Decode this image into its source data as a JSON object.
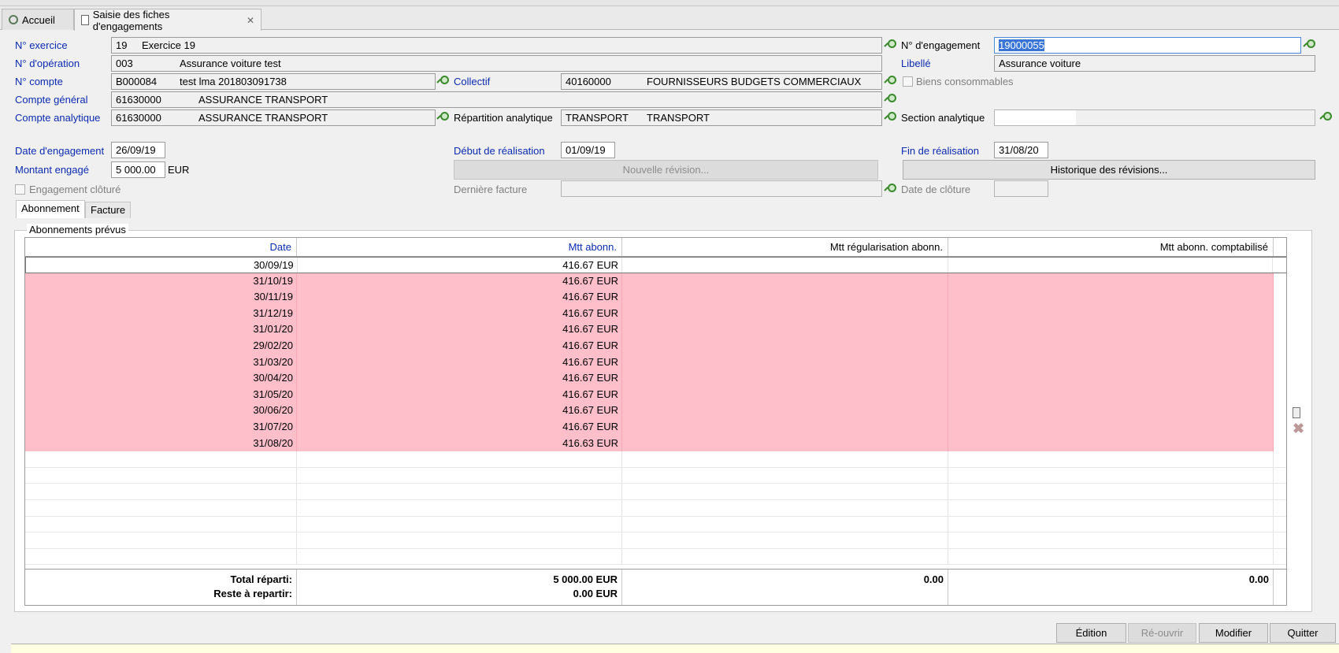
{
  "tabs": [
    {
      "label": "Accueil",
      "icon": "gear-icon",
      "active": false
    },
    {
      "label": "Saisie des fiches d'engagements",
      "icon": "document-icon",
      "active": true
    }
  ],
  "form": {
    "exercice": {
      "label": "N° exercice",
      "code": "19",
      "name": "Exercice 19"
    },
    "operation": {
      "label": "N° d'opération",
      "code": "003",
      "name": "Assurance voiture test"
    },
    "compte": {
      "label": "N° compte",
      "code": "B000084",
      "name": "test lma 201803091738"
    },
    "collectif": {
      "label": "Collectif",
      "code": "40160000",
      "name": "FOURNISSEURS BUDGETS COMMERCIAUX"
    },
    "compte_general": {
      "label": "Compte général",
      "code": "61630000",
      "name": "ASSURANCE TRANSPORT"
    },
    "compte_analytique": {
      "label": "Compte analytique",
      "code": "61630000",
      "name": "ASSURANCE TRANSPORT"
    },
    "repartition": {
      "label": "Répartition analytique",
      "code": "TRANSPORT",
      "name": "TRANSPORT"
    },
    "engagement": {
      "label": "N° d'engagement",
      "value": "19000055"
    },
    "libelle": {
      "label": "Libellé",
      "value": "Assurance voiture"
    },
    "biens": {
      "label": "Biens consommables"
    },
    "section": {
      "label": "Section analytique",
      "value": ""
    },
    "date_engagement": {
      "label": "Date d'engagement",
      "value": "26/09/19"
    },
    "debut_realisation": {
      "label": "Début de réalisation",
      "value": "01/09/19"
    },
    "fin_realisation": {
      "label": "Fin de réalisation",
      "value": "31/08/20"
    },
    "montant": {
      "label": "Montant engagé",
      "value": "5 000.00",
      "currency": "EUR"
    },
    "nouvelle_revision": "Nouvelle révision...",
    "historique": "Historique des révisions...",
    "cloture": {
      "label": "Engagement clôturé"
    },
    "derniere_facture": {
      "label": "Dernière facture"
    },
    "date_cloture": {
      "label": "Date de clôture"
    }
  },
  "subtabs": [
    "Abonnement",
    "Facture"
  ],
  "panel_title": "Abonnements prévus",
  "table": {
    "headers": [
      "Date",
      "Mtt abonn.",
      "Mtt régularisation abonn.",
      "Mtt abonn. comptabilisé"
    ],
    "rows": [
      [
        "30/09/19",
        "416.67 EUR"
      ],
      [
        "31/10/19",
        "416.67 EUR"
      ],
      [
        "30/11/19",
        "416.67 EUR"
      ],
      [
        "31/12/19",
        "416.67 EUR"
      ],
      [
        "31/01/20",
        "416.67 EUR"
      ],
      [
        "29/02/20",
        "416.67 EUR"
      ],
      [
        "31/03/20",
        "416.67 EUR"
      ],
      [
        "30/04/20",
        "416.67 EUR"
      ],
      [
        "31/05/20",
        "416.67 EUR"
      ],
      [
        "30/06/20",
        "416.67 EUR"
      ],
      [
        "31/07/20",
        "416.67 EUR"
      ],
      [
        "31/08/20",
        "416.63 EUR"
      ]
    ],
    "totals_labels": "Total réparti:\nReste à repartir:",
    "totals_mtt": "5 000.00 EUR\n0.00 EUR",
    "totals_regul": "0.00",
    "totals_compta": "0.00"
  },
  "buttons": {
    "edition": "Édition",
    "reouvrir": "Ré-ouvrir",
    "modifier": "Modifier",
    "quitter": "Quitter"
  },
  "colors": {
    "label_blue": "#0b2bb0",
    "pink_row": "#ffbfca",
    "selection": "#3875d7"
  }
}
